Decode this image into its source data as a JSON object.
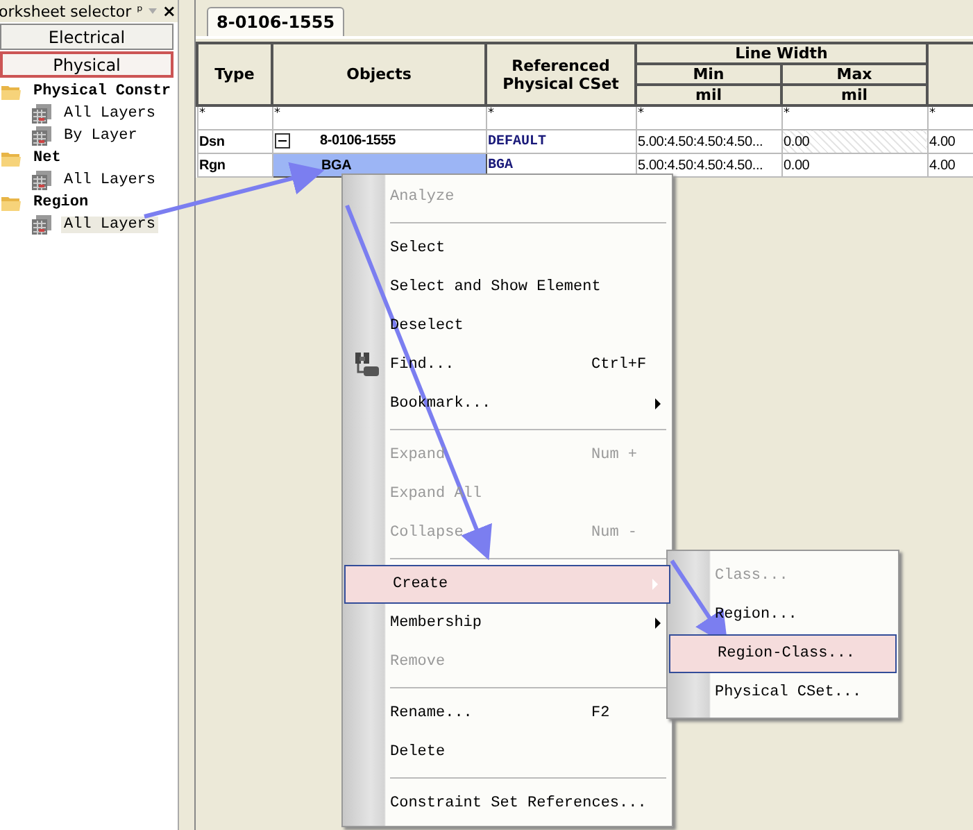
{
  "selector": {
    "title": "orksheet selector",
    "pin": "ᵖ",
    "close": "×",
    "worksheets": [
      {
        "label": "Electrical",
        "selected": false
      },
      {
        "label": "Physical",
        "selected": true
      }
    ],
    "tree": [
      {
        "label": "Physical Constr",
        "kind": "folder",
        "children": [
          {
            "label": "All Layers",
            "kind": "sheet",
            "selected": false
          },
          {
            "label": "By Layer",
            "kind": "sheet",
            "selected": false
          }
        ]
      },
      {
        "label": "Net",
        "kind": "folder",
        "children": [
          {
            "label": "All Layers",
            "kind": "sheet",
            "selected": false
          }
        ]
      },
      {
        "label": "Region",
        "kind": "folder",
        "children": [
          {
            "label": "All Layers",
            "kind": "sheet",
            "selected": true
          }
        ]
      }
    ]
  },
  "tab": {
    "label": "8-0106-1555",
    "selected": true
  },
  "grid": {
    "headers": {
      "type": "Type",
      "objects": "Objects",
      "cset": "Referenced Physical CSet",
      "group": "Line Width",
      "min": "Min",
      "max": "Max",
      "min_unit": "mil",
      "max_unit": "mil"
    },
    "filters": [
      "*",
      "*",
      "*",
      "*",
      "*",
      "*"
    ],
    "rows": [
      {
        "type": "Dsn",
        "object": "8-0106-1555",
        "expanded": true,
        "selected": false,
        "cset": "DEFAULT",
        "min": "5.00:4.50:4.50:4.50...",
        "max": "0.00",
        "hatched": true,
        "column_6": "4.00"
      },
      {
        "type": "Rgn",
        "object": "BGA",
        "selected": true,
        "cset": "BGA",
        "min": "5.00:4.50:4.50:4.50...",
        "max": "0.00",
        "hatched": false,
        "column_6": "4.00"
      }
    ]
  },
  "context_menu": [
    {
      "kind": "item",
      "label": "Analyze",
      "disabled": true,
      "selected": false
    },
    {
      "kind": "separator"
    },
    {
      "kind": "item",
      "label": "Select",
      "disabled": false,
      "selected": false
    },
    {
      "kind": "item",
      "label": "Select and Show Element",
      "disabled": false,
      "selected": false
    },
    {
      "kind": "item",
      "label": "Deselect",
      "disabled": false,
      "selected": false
    },
    {
      "kind": "item",
      "label": "Find...",
      "shortcut": "Ctrl+F",
      "icon": true,
      "disabled": false,
      "selected": false
    },
    {
      "kind": "item",
      "label": "Bookmark...",
      "submenu": true,
      "disabled": false,
      "selected": false
    },
    {
      "kind": "separator"
    },
    {
      "kind": "item",
      "label": "Expand",
      "shortcut": "Num +",
      "disabled": true,
      "selected": false
    },
    {
      "kind": "item",
      "label": "Expand All",
      "disabled": true,
      "selected": false
    },
    {
      "kind": "item",
      "label": "Collapse",
      "shortcut": "Num -",
      "disabled": true,
      "selected": false
    },
    {
      "kind": "separator"
    },
    {
      "kind": "item",
      "label": "Create",
      "submenu": true,
      "disabled": false,
      "selected": true
    },
    {
      "kind": "item",
      "label": "Membership",
      "submenu": true,
      "disabled": false,
      "selected": false
    },
    {
      "kind": "item",
      "label": "Remove",
      "disabled": true,
      "selected": false
    },
    {
      "kind": "separator"
    },
    {
      "kind": "item",
      "label": "Rename...",
      "shortcut": "F2",
      "disabled": false,
      "selected": false
    },
    {
      "kind": "item",
      "label": "Delete",
      "disabled": false,
      "selected": false
    },
    {
      "kind": "separator"
    },
    {
      "kind": "item",
      "label": "Constraint Set References...",
      "disabled": false,
      "selected": false
    }
  ],
  "submenu": [
    {
      "kind": "item",
      "label": "Class...",
      "disabled": true,
      "selected": false
    },
    {
      "kind": "item",
      "label": "Region...",
      "disabled": false,
      "selected": false
    },
    {
      "kind": "item",
      "label": "Region-Class...",
      "disabled": false,
      "selected": true
    },
    {
      "kind": "item",
      "label": "Physical CSet...",
      "disabled": false,
      "selected": false
    }
  ]
}
